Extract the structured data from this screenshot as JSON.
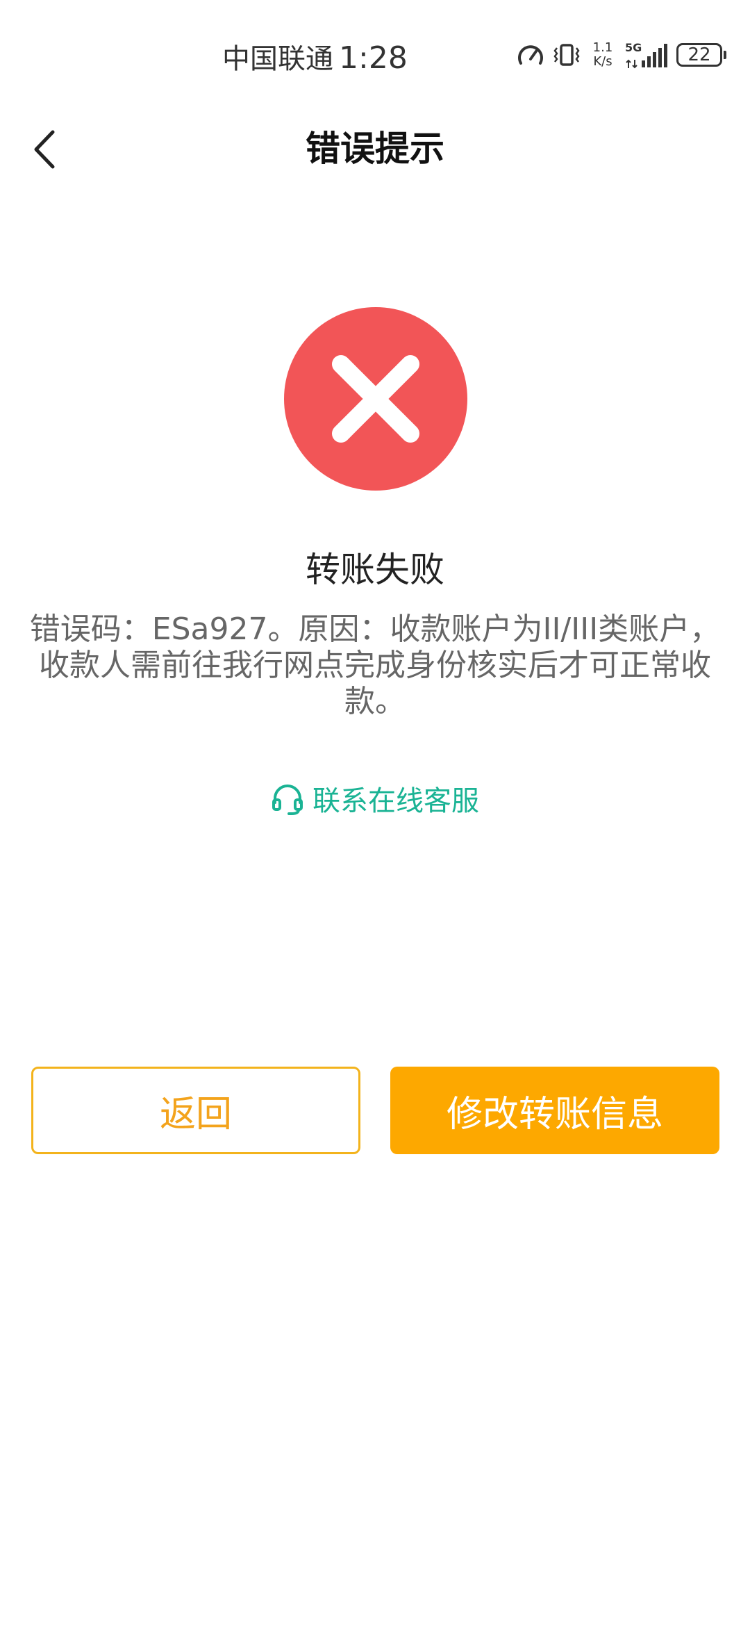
{
  "status_bar": {
    "carrier": "中国联通",
    "time": "1:28",
    "net_speed_value": "1.1",
    "net_speed_unit": "K/s",
    "network": "5G",
    "battery": "22"
  },
  "nav": {
    "title": "错误提示"
  },
  "result": {
    "title": "转账失败",
    "message": "错误码：ESa927。原因：收款账户为II/III类账户，收款人需前往我行网点完成身份核实后才可正常收款。",
    "icon_color": "#f25557"
  },
  "contact": {
    "label": "联系在线客服",
    "color": "#1ab394"
  },
  "buttons": {
    "back_label": "返回",
    "modify_label": "修改转账信息",
    "accent": "#fda800"
  }
}
